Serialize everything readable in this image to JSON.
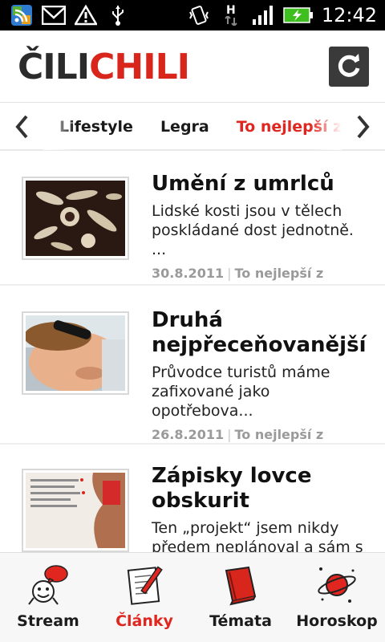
{
  "status_bar": {
    "time": "12:42",
    "network_type": "H",
    "icons": [
      "rss-icon",
      "gmail-icon",
      "warning-icon",
      "usb-icon",
      "vibrate-icon",
      "network-h-icon",
      "signal-icon",
      "battery-charging-icon"
    ]
  },
  "header": {
    "logo_part1": "ČILI",
    "logo_part2": "CHILI",
    "refresh_icon": "refresh-icon"
  },
  "categories": {
    "items": [
      "Lifestyle",
      "Legra",
      "To nejlepší z"
    ],
    "active": "To nejlepší z"
  },
  "articles": [
    {
      "title": "Umění z umrlců",
      "description": "Lidské kosti jsou v tělech poskládané dost jednotně. ...",
      "date": "30.8.2011",
      "category": "To nejlepší z"
    },
    {
      "title": "Druhá nejpřeceňovanější",
      "description": "Průvodce turistů máme zafixované jako opotřebova...",
      "date": "26.8.2011",
      "category": "To nejlepší z"
    },
    {
      "title": "Zápisky lovce obskurit",
      "description": "Ten „projekt“ jsem nikdy předem neplánoval a sám s",
      "date": "",
      "category": ""
    }
  ],
  "bottom_nav": [
    {
      "label": "Stream",
      "icon": "stream-icon"
    },
    {
      "label": "Články",
      "icon": "articles-icon"
    },
    {
      "label": "Témata",
      "icon": "book-icon"
    },
    {
      "label": "Horoskop",
      "icon": "planet-icon"
    }
  ],
  "colors": {
    "accent": "#e0261f",
    "status_bar": "#000000",
    "battery": "#3fbf1f"
  }
}
